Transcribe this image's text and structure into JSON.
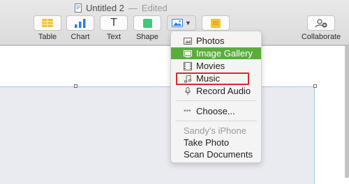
{
  "window": {
    "title": "Untitled 2",
    "separator": "—",
    "status": "Edited"
  },
  "toolbar": {
    "table_label": "Table",
    "chart_label": "Chart",
    "text_label": "Text",
    "shape_label": "Shape",
    "collaborate_label": "Collaborate",
    "text_glyph": "T"
  },
  "media_menu": {
    "items": [
      {
        "label": "Photos",
        "icon": "photos-icon"
      },
      {
        "label": "Image Gallery",
        "icon": "image-gallery-icon",
        "selected": true
      },
      {
        "label": "Movies",
        "icon": "movies-icon"
      },
      {
        "label": "Music",
        "icon": "music-icon"
      },
      {
        "label": "Record Audio",
        "icon": "microphone-icon"
      }
    ],
    "choose_label": "Choose...",
    "device_header": "Sandy's iPhone",
    "take_photo_label": "Take Photo",
    "scan_documents_label": "Scan Documents"
  },
  "colors": {
    "selection_green": "#5aad3d",
    "annotation_red": "#e0262c",
    "chart_blue": "#2f7fe0",
    "table_yellow": "#f3c22d",
    "shape_green": "#3fc97a",
    "comment_yellow": "#f5c233"
  }
}
